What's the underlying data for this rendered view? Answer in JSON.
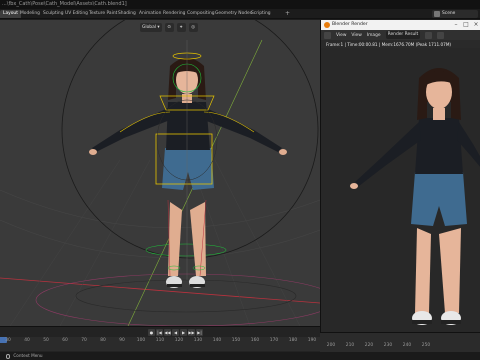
{
  "window": {
    "title": "...\\fbx_Cath\\Pose\\Cath_Model\\Assets\\Cath.blend1]"
  },
  "tabs": [
    {
      "label": "Layout"
    },
    {
      "label": "Modeling"
    },
    {
      "label": "Sculpting"
    },
    {
      "label": "UV Editing"
    },
    {
      "label": "Texture Paint"
    },
    {
      "label": "Shading"
    },
    {
      "label": "Animation"
    },
    {
      "label": "Rendering"
    },
    {
      "label": "Compositing"
    },
    {
      "label": "Geometry Nodes"
    },
    {
      "label": "Scripting"
    }
  ],
  "scene": {
    "label": "Scene"
  },
  "viewport": {
    "orientation": "Global"
  },
  "render_window": {
    "title": "Blender Render",
    "menu": [
      "View",
      "View",
      "Image"
    ],
    "slot": "Render Result",
    "status": "Frame:1 | Time:00:00.81 | Mem:1676.70M (Peak 1711.07M)"
  },
  "timeline": {
    "ticks": [
      "30",
      "40",
      "50",
      "60",
      "70",
      "80",
      "90",
      "100",
      "110",
      "120",
      "130",
      "140",
      "150",
      "160",
      "170",
      "180",
      "190",
      "200",
      "210",
      "220",
      "230",
      "240",
      "250"
    ],
    "current_frame": "1"
  },
  "statusbar": {
    "hint": "Context Menu"
  },
  "colors": {
    "accent": "#4772b3",
    "viewport_bg": "#3a3a3a",
    "render_bg": "#282828",
    "bone_yellow": "#e6c400",
    "bone_green": "#1fbf3a",
    "grid_red": "#b8323e",
    "skin": "#e6b59a",
    "denim": "#3f6b90",
    "top_black": "#1b1e24"
  }
}
